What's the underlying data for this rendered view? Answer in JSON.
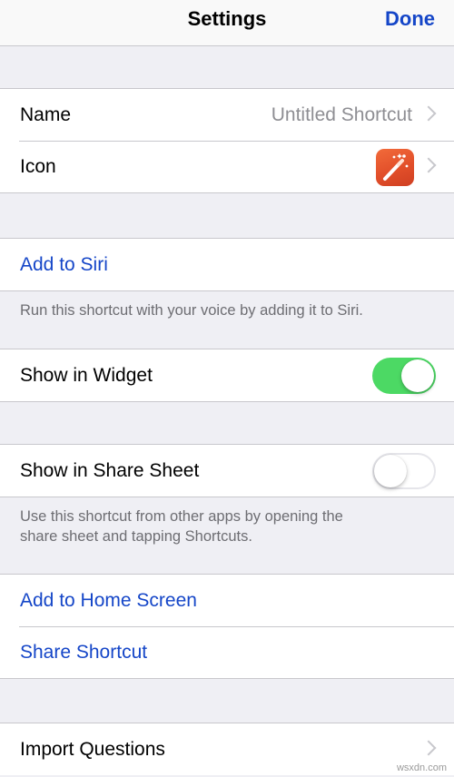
{
  "navbar": {
    "title": "Settings",
    "done_label": "Done"
  },
  "group1": {
    "name_label": "Name",
    "name_value": "Untitled Shortcut",
    "icon_label": "Icon",
    "icon_name": "magic-wand-icon"
  },
  "siri": {
    "add_label": "Add to Siri",
    "footer": "Run this shortcut with your voice by adding it to Siri."
  },
  "widget": {
    "label": "Show in Widget",
    "enabled": true
  },
  "share_sheet": {
    "label": "Show in Share Sheet",
    "enabled": false,
    "footer_line1": "Use this shortcut from other apps by opening the",
    "footer_line2": "share sheet and tapping Shortcuts."
  },
  "actions": {
    "home_screen_label": "Add to Home Screen",
    "share_label": "Share Shortcut"
  },
  "import": {
    "label": "Import Questions"
  },
  "watermark": "wsxdn.com",
  "colors": {
    "accent": "#1546c8",
    "toggle_on": "#4cd964",
    "background": "#efeff4"
  }
}
